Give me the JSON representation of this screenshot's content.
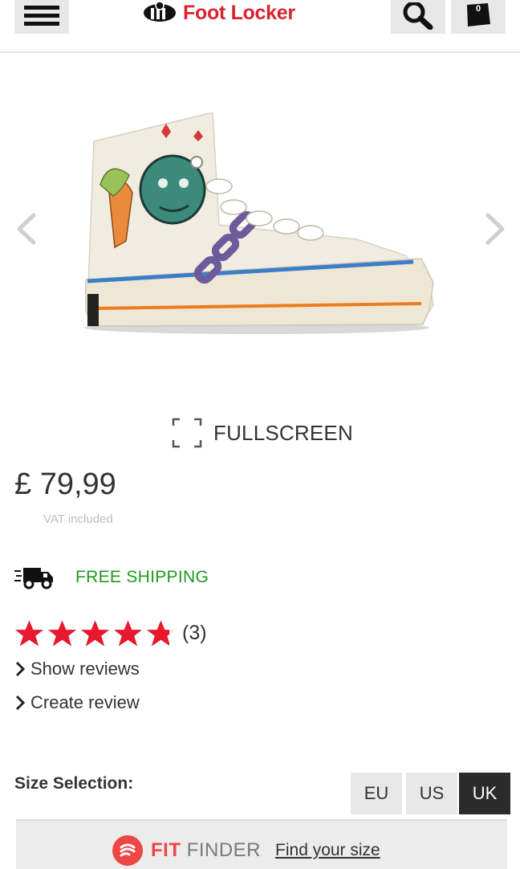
{
  "header": {
    "logo_text": "Foot Locker",
    "menu_icon": "hamburger-menu-icon",
    "search_icon": "search-icon",
    "bag_icon": "shopping-bag-icon",
    "bag_count": "0"
  },
  "gallery": {
    "image_alt": "hand-painted high-top canvas sneaker",
    "prev_icon": "chevron-left-icon",
    "next_icon": "chevron-right-icon"
  },
  "fullscreen": {
    "label": "FULLSCREEN",
    "icon": "fullscreen-icon"
  },
  "product": {
    "price": "£ 79,99",
    "vat": "VAT included"
  },
  "shipping": {
    "label": "FREE SHIPPING",
    "icon": "delivery-truck-icon"
  },
  "rating": {
    "stars": 4.8,
    "max": 5,
    "count": "(3)"
  },
  "links": {
    "show_reviews": "Show reviews",
    "create_review": "Create review"
  },
  "size": {
    "label": "Size Selection:",
    "options": [
      "EU",
      "US",
      "UK"
    ],
    "selected": "UK"
  },
  "fit_finder": {
    "brand_fit": "FIT",
    "brand_finder": "FINDER",
    "link": "Find your size"
  },
  "colors": {
    "brand_red": "#d9232e",
    "shipping_green": "#1f9a1f",
    "star_red": "#e8192c",
    "fit_red": "#ee4545"
  }
}
